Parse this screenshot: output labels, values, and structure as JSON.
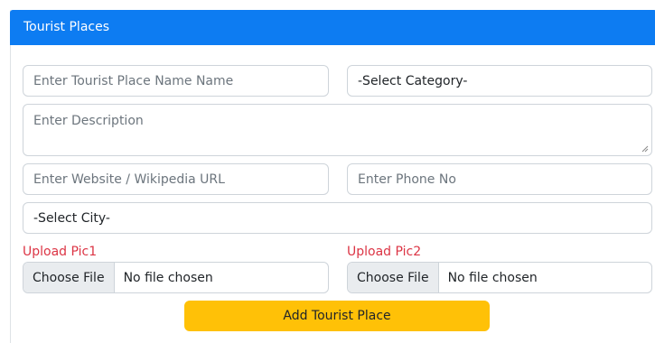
{
  "header": {
    "title": "Tourist Places"
  },
  "form": {
    "place_name_placeholder": "Enter Tourist Place Name Name",
    "category_selected": "-Select Category-",
    "description_placeholder": "Enter Description",
    "website_placeholder": "Enter Website / Wikipedia URL",
    "phone_placeholder": "Enter Phone No",
    "city_selected": "-Select City-",
    "upload1": {
      "label": "Upload Pic1",
      "button": "Choose File",
      "status": "No file chosen"
    },
    "upload2": {
      "label": "Upload Pic2",
      "button": "Choose File",
      "status": "No file chosen"
    },
    "submit_label": "Add Tourist Place"
  },
  "colors": {
    "header_bg": "#0d7cf2",
    "upload_label": "#dc3545",
    "submit_bg": "#ffc107"
  }
}
